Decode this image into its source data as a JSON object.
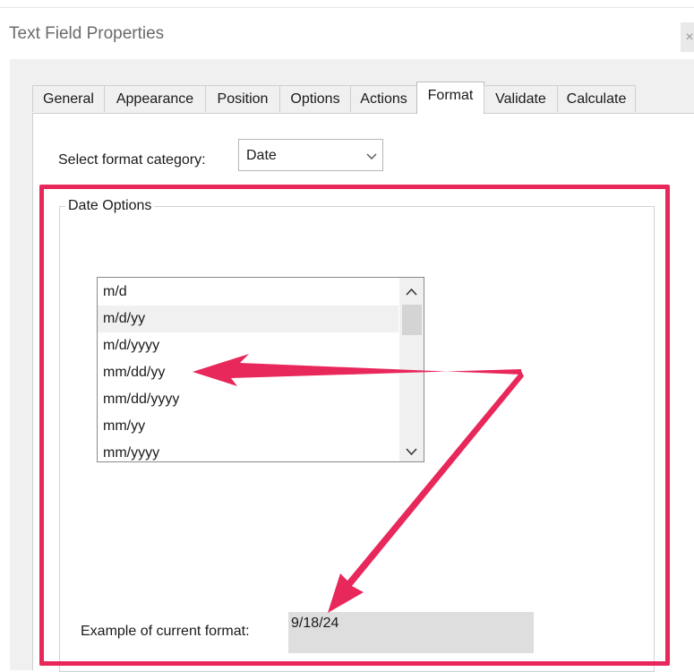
{
  "window": {
    "title": "Text Field Properties",
    "close_glyph": "×"
  },
  "tabs": [
    {
      "label": "General"
    },
    {
      "label": "Appearance"
    },
    {
      "label": "Position"
    },
    {
      "label": "Options"
    },
    {
      "label": "Actions"
    },
    {
      "label": "Format",
      "active": true
    },
    {
      "label": "Validate"
    },
    {
      "label": "Calculate"
    }
  ],
  "format": {
    "category_label": "Select format category:",
    "category_value": "Date",
    "chevron_icon": "chevron-down-icon"
  },
  "date_options": {
    "group_title": "Date Options",
    "items": [
      {
        "label": "m/d"
      },
      {
        "label": "m/d/yy",
        "selected": true
      },
      {
        "label": "m/d/yyyy"
      },
      {
        "label": "mm/dd/yy"
      },
      {
        "label": "mm/dd/yyyy"
      },
      {
        "label": "mm/yy"
      },
      {
        "label": "mm/yyyy"
      }
    ]
  },
  "example": {
    "label": "Example of current format:",
    "value": "9/18/24"
  },
  "colors": {
    "annotation": "#e8275a",
    "panel_bg": "#f0f0f0",
    "selection": "#f0f0f0"
  }
}
